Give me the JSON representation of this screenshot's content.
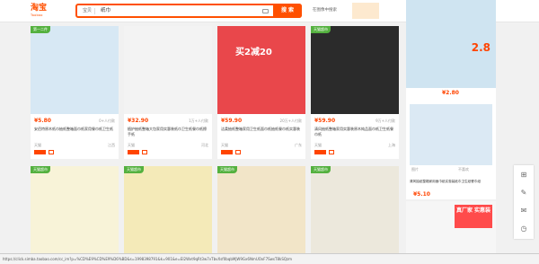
{
  "header": {
    "logo": "淘宝",
    "logo_sub": "Taobao",
    "search_category": "宝贝",
    "search_value": "纸巾",
    "search_button": "搜 索",
    "image_search_label": "在图像中搜索"
  },
  "products": [
    {
      "price": "¥5.80",
      "sold": "0+人付款",
      "title": "安佰特原木纸巾抽纸整箱面巾纸家用餐巾纸卫生纸",
      "shop": "天猫",
      "location": "江西"
    },
    {
      "price": "¥32.90",
      "sold": "1万+人付款",
      "title": "植护抽纸整箱大包家用实惠装纸巾卫生纸餐巾纸擦手纸",
      "shop": "天猫",
      "location": "河北"
    },
    {
      "price": "¥59.90",
      "sold": "20万+人付款",
      "title": "洁柔抽纸整箱家用卫生纸面巾纸抽纸餐巾纸实惠装",
      "shop": "天猫",
      "location": "广东"
    },
    {
      "price": "¥59.90",
      "sold": "9万+人付款",
      "title": "清风抽纸整箱家用实惠装原木纯品面巾纸卫生纸餐巾纸",
      "shop": "天猫",
      "location": "上海"
    }
  ],
  "product_labels": [
    "第一二件",
    "买2减20",
    "天猫超市"
  ],
  "side": {
    "top_price": "¥2.80",
    "top_price_big": "2.8",
    "btn_left": "图片",
    "btn_right": "不喜欢",
    "title": "清风抽纸整箱家用面巾纸实惠装纸巾卫生纸餐巾纸",
    "price": "¥5.10",
    "ad_tag": "真厂家 实惠装"
  },
  "status_bar": "https://click.simba.taobao.com/cc_im?p=%CD%E9%CD%E9%D6%BD&s=1998398791&k=901&e=EI2Wxt9qRt3w7vTbvXsf0bqbMjW9Gx6NmUOxF7SwsT8kSQzm"
}
